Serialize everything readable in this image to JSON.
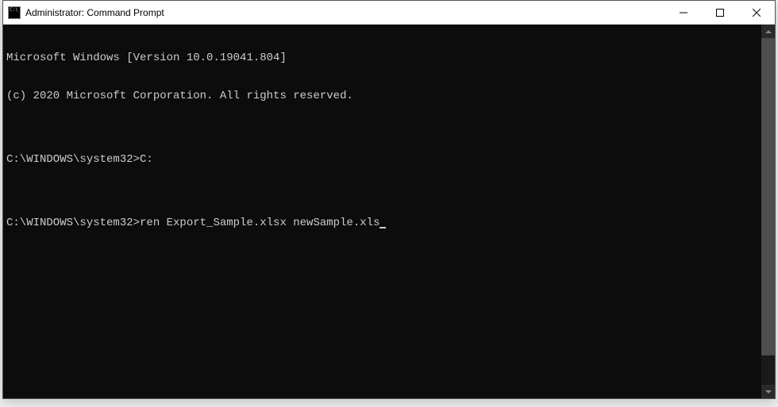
{
  "window": {
    "title": "Administrator: Command Prompt"
  },
  "terminal": {
    "lines": [
      "Microsoft Windows [Version 10.0.19041.804]",
      "(c) 2020 Microsoft Corporation. All rights reserved.",
      "",
      "C:\\WINDOWS\\system32>C:",
      "",
      "C:\\WINDOWS\\system32>ren Export_Sample.xlsx newSample.xls"
    ]
  }
}
